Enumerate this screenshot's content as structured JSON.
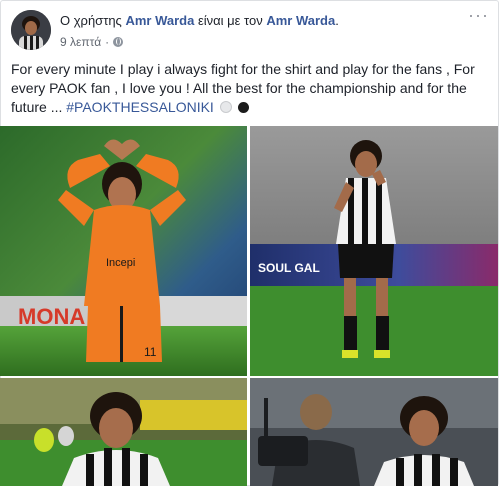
{
  "post": {
    "author_prefix": "Ο χρήστης ",
    "author": "Amr Warda",
    "connector": " είναι με τον ",
    "tagged": "Amr Warda",
    "tail": ".",
    "time": "9 λεπτά",
    "separator": "·",
    "privacy_icon": "globe-icon",
    "menu_icon": "more-options-icon",
    "text": "For every minute I play i always fight for the shirt and play for the fans , For every PAOK fan , I love you ! All the best for the championship and for the future ... ",
    "hashtag": "#PAOKTHESSALONIKI",
    "emoji": [
      "white-circle",
      "black-circle"
    ]
  },
  "photos": {
    "count": 4,
    "p1": {
      "jersey_text": "Incepi",
      "number": "11",
      "banner_text": "MONA"
    },
    "p2": {
      "banner_text": "SOUL GAL"
    },
    "p3": {},
    "p4": {}
  },
  "colors": {
    "link": "#385898",
    "text": "#1d2129",
    "meta": "#616770",
    "orange_kit": "#f07b22"
  }
}
